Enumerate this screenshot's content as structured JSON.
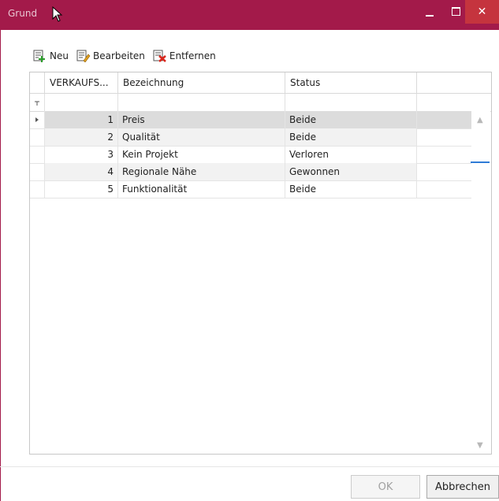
{
  "window": {
    "title": "Grund"
  },
  "toolbar": {
    "new_label": "Neu",
    "edit_label": "Bearbeiten",
    "remove_label": "Entfernen"
  },
  "grid": {
    "columns": [
      "VERKAUFS...",
      "Bezeichnung",
      "Status"
    ],
    "rows": [
      {
        "num": "1",
        "name": "Preis",
        "status": "Beide"
      },
      {
        "num": "2",
        "name": "Qualität",
        "status": "Beide"
      },
      {
        "num": "3",
        "name": "Kein Projekt",
        "status": "Verloren"
      },
      {
        "num": "4",
        "name": "Regionale Nähe",
        "status": "Gewonnen"
      },
      {
        "num": "5",
        "name": "Funktionalität",
        "status": "Beide"
      }
    ]
  },
  "footer": {
    "ok_label": "OK",
    "cancel_label": "Abbrechen"
  },
  "colors": {
    "titlebar": "#a31a4a",
    "close": "#c5343e",
    "accent": "#2f7bd6"
  }
}
